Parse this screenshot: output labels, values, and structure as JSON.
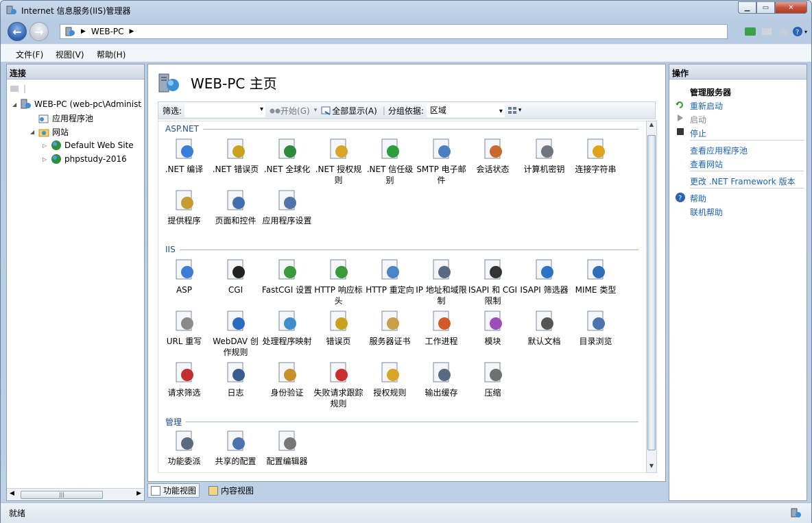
{
  "window": {
    "title": "Internet 信息服务(IIS)管理器"
  },
  "address": {
    "crumb": "WEB-PC"
  },
  "menu": [
    {
      "label": "文件(F)"
    },
    {
      "label": "视图(V)"
    },
    {
      "label": "帮助(H)"
    }
  ],
  "connections": {
    "header": "连接",
    "tree": [
      {
        "label": "WEB-PC (web-pc\\Administ",
        "exp": "◢"
      },
      {
        "label": "应用程序池",
        "exp": ""
      },
      {
        "label": "网站",
        "exp": "◢"
      },
      {
        "label": "Default Web Site",
        "exp": "▷"
      },
      {
        "label": "phpstudy-2016",
        "exp": "▷"
      }
    ],
    "scroll_thumb": "|||"
  },
  "main": {
    "title": "WEB-PC 主页",
    "filter_label": "筛选:",
    "start_label": "开始(G)",
    "show_all_label": "全部显示(A)",
    "group_by_label": "分组依据:",
    "group_by_value": "区域",
    "sections": [
      {
        "label": "ASP.NET"
      },
      {
        "label": "IIS"
      },
      {
        "label": "管理"
      }
    ],
    "aspnet": [
      {
        "label": ".NET 编译",
        "color": "#3b7dd8"
      },
      {
        "label": ".NET 错误页",
        "color": "#c8a320"
      },
      {
        "label": ".NET 全球化",
        "color": "#2c8a3a"
      },
      {
        "label": ".NET 授权规则",
        "color": "#d8a626"
      },
      {
        "label": ".NET 信任级别",
        "color": "#2d9c3c"
      },
      {
        "label": "SMTP 电子邮件",
        "color": "#4a7fc1"
      },
      {
        "label": "会话状态",
        "color": "#c76a2c"
      },
      {
        "label": "计算机密钥",
        "color": "#6e7781"
      },
      {
        "label": "连接字符串",
        "color": "#e0a21a"
      },
      {
        "label": "提供程序",
        "color": "#c89a30"
      },
      {
        "label": "页面和控件",
        "color": "#3f6fae"
      },
      {
        "label": "应用程序设置",
        "color": "#4f74a8"
      }
    ],
    "iis": [
      {
        "label": "ASP",
        "color": "#3f7bd0"
      },
      {
        "label": "CGI",
        "color": "#222222"
      },
      {
        "label": "FastCGI 设置",
        "color": "#3a9a3a"
      },
      {
        "label": "HTTP 响应标头",
        "color": "#3a9a3a"
      },
      {
        "label": "HTTP 重定向",
        "color": "#4a84c9"
      },
      {
        "label": "IP 地址和域限制",
        "color": "#5a6a80"
      },
      {
        "label": "ISAPI 和 CGI 限制",
        "color": "#333333"
      },
      {
        "label": "ISAPI 筛选器",
        "color": "#2e73c2"
      },
      {
        "label": "MIME 类型",
        "color": "#2e6fb8"
      },
      {
        "label": "URL 重写",
        "color": "#8a8a8a"
      },
      {
        "label": "WebDAV 创作规则",
        "color": "#2a6ac0"
      },
      {
        "label": "处理程序映射",
        "color": "#3f8fd0"
      },
      {
        "label": "错误页",
        "color": "#c8a320"
      },
      {
        "label": "服务器证书",
        "color": "#c9a048"
      },
      {
        "label": "工作进程",
        "color": "#d55a2a"
      },
      {
        "label": "模块",
        "color": "#9a50b8"
      },
      {
        "label": "默认文档",
        "color": "#555555"
      },
      {
        "label": "目录浏览",
        "color": "#4a74ae"
      },
      {
        "label": "请求筛选",
        "color": "#c03030"
      },
      {
        "label": "日志",
        "color": "#3a5c8c"
      },
      {
        "label": "身份验证",
        "color": "#c8902a"
      },
      {
        "label": "失败请求跟踪规则",
        "color": "#c83030"
      },
      {
        "label": "授权规则",
        "color": "#d8a626"
      },
      {
        "label": "输出缓存",
        "color": "#5a6a80"
      },
      {
        "label": "压缩",
        "color": "#707070"
      }
    ],
    "manage": [
      {
        "label": "功能委派",
        "color": "#5a6a80"
      },
      {
        "label": "共享的配置",
        "color": "#4a74ae"
      },
      {
        "label": "配置编辑器",
        "color": "#777777"
      }
    ]
  },
  "tabs": [
    {
      "label": "功能视图"
    },
    {
      "label": "内容视图"
    }
  ],
  "actions": {
    "header": "操作",
    "group_title": "管理服务器",
    "restart": "重新启动",
    "start": "启动",
    "stop": "停止",
    "view_pools": "查看应用程序池",
    "view_sites": "查看网站",
    "change_framework": "更改 .NET Framework 版本",
    "help": "帮助",
    "online_help": "联机帮助"
  },
  "status": {
    "text": "就绪"
  }
}
